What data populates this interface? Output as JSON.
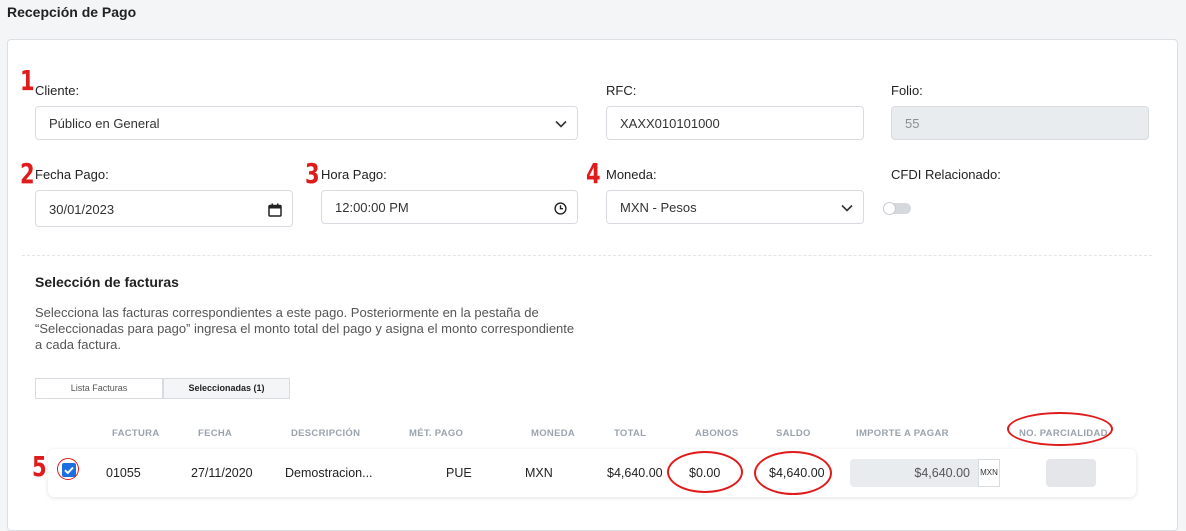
{
  "page": {
    "title": "Recepción de Pago"
  },
  "markers": {
    "m1": "1",
    "m2": "2",
    "m3": "3",
    "m4": "4",
    "m5": "5"
  },
  "form": {
    "cliente": {
      "label": "Cliente:",
      "value": "Público en General"
    },
    "rfc": {
      "label": "RFC:",
      "value": "XAXX010101000"
    },
    "folio": {
      "label": "Folio:",
      "value": "55"
    },
    "fecha_pago": {
      "label": "Fecha Pago:",
      "value": "30/01/2023"
    },
    "hora_pago": {
      "label": "Hora Pago:",
      "value": "12:00:00 PM"
    },
    "moneda": {
      "label": "Moneda:",
      "value": "MXN - Pesos"
    },
    "cfdi_relacionado": {
      "label": "CFDI Relacionado:",
      "enabled": false
    }
  },
  "seleccion": {
    "title": "Selección de facturas",
    "description": "Selecciona las facturas correspondientes a este pago. Posteriormente en la pestaña de “Seleccionadas para pago” ingresa el monto total del pago y asigna el monto correspondiente a cada factura."
  },
  "tabs": [
    {
      "label": "Lista Facturas",
      "active": false
    },
    {
      "label": "Seleccionadas (1)",
      "active": true
    }
  ],
  "table": {
    "headers": {
      "factura": "FACTURA",
      "fecha": "FECHA",
      "descripcion": "DESCRIPCIÓN",
      "metodo": "MÉT. PAGO",
      "moneda": "MONEDA",
      "total": "TOTAL",
      "abonos": "ABONOS",
      "saldo": "SALDO",
      "importe": "IMPORTE A PAGAR",
      "parcialidad": "NO. PARCIALIDAD"
    },
    "rows": [
      {
        "checked": true,
        "factura": "01055",
        "fecha": "27/11/2020",
        "descripcion": "Demostracion...",
        "metodo": "PUE",
        "moneda": "MXN",
        "total": "$4,640.00",
        "abonos": "$0.00",
        "saldo": "$4,640.00",
        "importe": "$4,640.00",
        "importe_currency": "MXN",
        "parcialidad": ""
      }
    ]
  },
  "colors": {
    "annotation_red": "#e01b1b",
    "checkbox_blue": "#1b6fe0",
    "header_gray": "#9aa3ad"
  }
}
